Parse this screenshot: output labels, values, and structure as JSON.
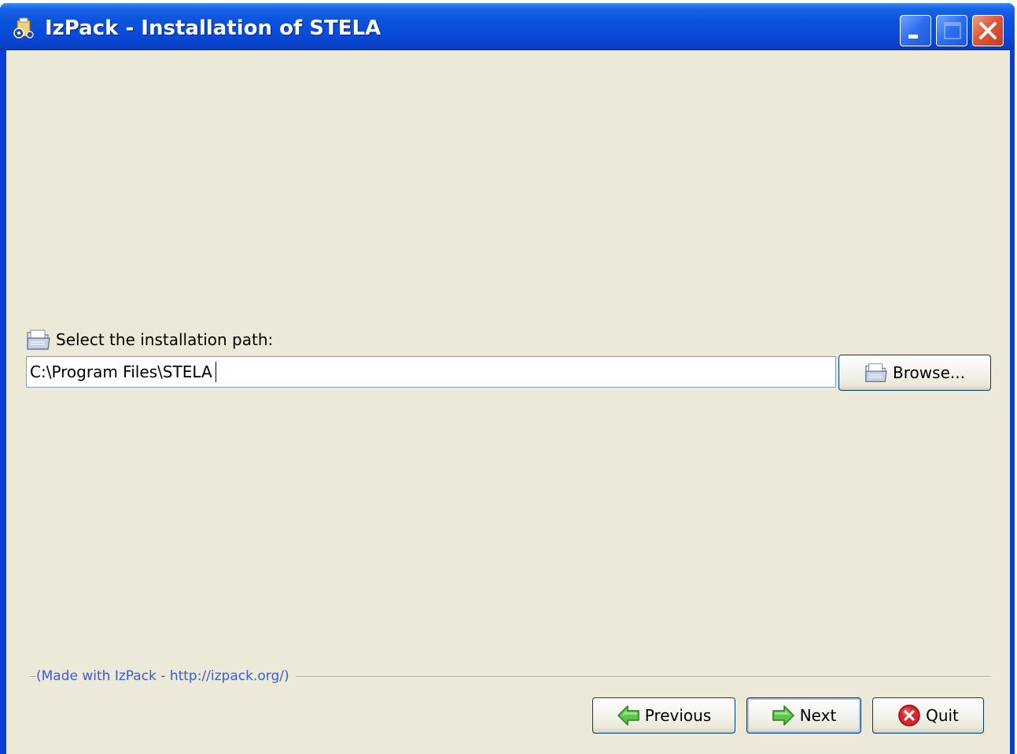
{
  "window": {
    "title": "IzPack - Installation of STELA"
  },
  "target_panel": {
    "label": "Select the installation path:",
    "path_value": "C:\\Program Files\\STELA",
    "browse_label": "Browse..."
  },
  "footer": {
    "credit": "(Made with IzPack - http://izpack.org/)"
  },
  "nav": {
    "previous_label": "Previous",
    "next_label": "Next",
    "quit_label": "Quit"
  },
  "colors": {
    "titlebar": "#0a52dc",
    "client_bg": "#ece9d8",
    "credit_text": "#3c5dc8",
    "close_button": "#e0583a"
  },
  "icons": {
    "app": "izpack-app-icon",
    "folder": "folder-icon",
    "previous": "arrow-left-icon",
    "next": "arrow-right-icon",
    "quit": "stop-icon"
  }
}
